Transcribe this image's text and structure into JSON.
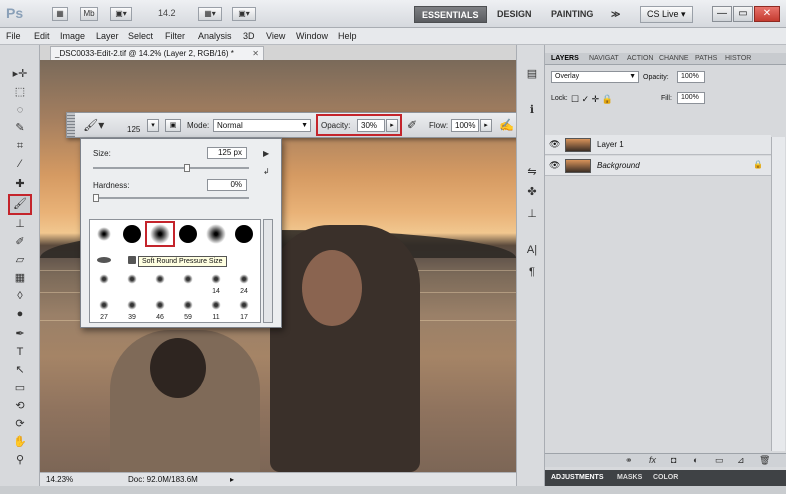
{
  "app_bar": {
    "logo": "Ps",
    "zoom": "14.2",
    "workspaces": [
      "ESSENTIALS",
      "DESIGN",
      "PAINTING"
    ],
    "overflow": "≫",
    "cs_live": "CS Live ▾",
    "window_controls": [
      "—",
      "▭",
      "✕"
    ]
  },
  "menu": [
    "File",
    "Edit",
    "Image",
    "Layer",
    "Select",
    "Filter",
    "Analysis",
    "3D",
    "View",
    "Window",
    "Help"
  ],
  "document": {
    "tab_title": "_DSC0033-Edit-2.tif @ 14.2% (Layer 2, RGB/16) *",
    "close": "✕"
  },
  "options_bar": {
    "brush_size": "125",
    "mode_label": "Mode:",
    "mode_value": "Normal",
    "opacity_label": "Opacity:",
    "opacity_value": "30%",
    "flow_label": "Flow:",
    "flow_value": "100%"
  },
  "brush_panel": {
    "size_label": "Size:",
    "size_value": "125 px",
    "hardness_label": "Hardness:",
    "hardness_value": "0%",
    "size_slider": 0.6,
    "hardness_slider": 0.0,
    "tooltip": "Soft Round Pressure Size",
    "brush_numbers": [
      "14",
      "24",
      "27",
      "39",
      "46",
      "59",
      "11",
      "17"
    ]
  },
  "layers_panel": {
    "tabs": [
      "LAYERS",
      "NAVIGAT",
      "ACTION",
      "CHANNE",
      "PATHS",
      "HISTOR"
    ],
    "blend_mode": "Overlay",
    "opacity_label": "Opacity:",
    "opacity_value": "100%",
    "lock_label": "Lock:",
    "fill_label": "Fill:",
    "fill_value": "100%",
    "layers": [
      {
        "name": "Layer 1"
      },
      {
        "name": "Background",
        "locked": true
      }
    ],
    "footer_icons": [
      "⚭",
      "fx",
      "◘",
      "◐",
      "▭",
      "⊿",
      "🗑"
    ],
    "bottom_tabs": [
      "ADJUSTMENTS",
      "MASKS",
      "COLOR"
    ]
  },
  "status_bar": {
    "zoom": "14.23%",
    "doc_info": "Doc: 92.0M/183.6M"
  },
  "colors": {
    "highlight": "#c4242b",
    "active_workspace": "#5a5c60"
  }
}
